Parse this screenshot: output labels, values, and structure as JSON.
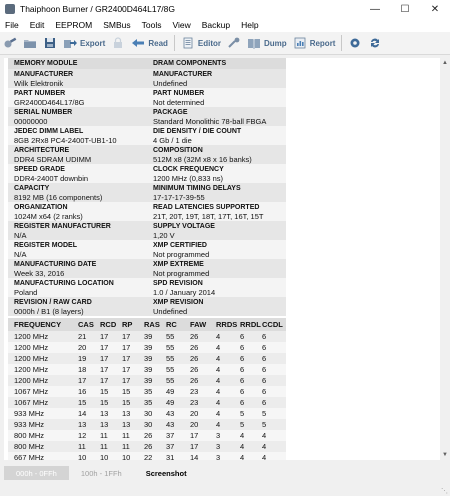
{
  "window": {
    "title": "Thaiphoon Burner / GR2400D464L17/8G"
  },
  "menu": [
    "File",
    "Edit",
    "EEPROM",
    "SMBus",
    "Tools",
    "View",
    "Backup",
    "Help"
  ],
  "toolbar": {
    "export": "Export",
    "read": "Read",
    "editor": "Editor",
    "dump": "Dump",
    "report": "Report"
  },
  "info": [
    {
      "left": {
        "label": "MEMORY MODULE",
        "value": ""
      },
      "right": {
        "label": "DRAM COMPONENTS",
        "value": ""
      }
    },
    {
      "left": {
        "label": "Manufacturer",
        "value": "Wilk Elektronik"
      },
      "right": {
        "label": "Manufacturer",
        "value": "Undefined"
      }
    },
    {
      "left": {
        "label": "Part Number",
        "value": "GR2400D464L17/8G"
      },
      "right": {
        "label": "Part Number",
        "value": "Not determined"
      }
    },
    {
      "left": {
        "label": "Serial Number",
        "value": "00000000"
      },
      "right": {
        "label": "Package",
        "value": "Standard Monolithic 78-ball FBGA"
      }
    },
    {
      "left": {
        "label": "JEDEC DIMM Label",
        "value": "8GB 2Rx8 PC4-2400T-UB1-10"
      },
      "right": {
        "label": "Die Density / Die Count",
        "value": "4 Gb / 1 die"
      }
    },
    {
      "left": {
        "label": "Architecture",
        "value": "DDR4 SDRAM UDIMM"
      },
      "right": {
        "label": "Composition",
        "value": "512M x8 (32M x8 x 16 banks)"
      }
    },
    {
      "left": {
        "label": "Speed Grade",
        "value": "DDR4-2400T downbin"
      },
      "right": {
        "label": "Clock Frequency",
        "value": "1200 MHz (0,833 ns)"
      }
    },
    {
      "left": {
        "label": "Capacity",
        "value": "8192 MB (16 components)"
      },
      "right": {
        "label": "Minimum Timing Delays",
        "value": "17-17-17-39-55"
      }
    },
    {
      "left": {
        "label": "Organization",
        "value": "1024M x64 (2 ranks)"
      },
      "right": {
        "label": "Read Latencies Supported",
        "value": "21T, 20T, 19T, 18T, 17T, 16T, 15T"
      }
    },
    {
      "left": {
        "label": "Register Manufacturer",
        "value": "N/A"
      },
      "right": {
        "label": "Supply Voltage",
        "value": "1,20 V"
      }
    },
    {
      "left": {
        "label": "Register Model",
        "value": "N/A"
      },
      "right": {
        "label": "XMP Certified",
        "value": "Not programmed"
      }
    },
    {
      "left": {
        "label": "Manufacturing Date",
        "value": "Week 33, 2016"
      },
      "right": {
        "label": "XMP Extreme",
        "value": "Not programmed"
      }
    },
    {
      "left": {
        "label": "Manufacturing Location",
        "value": "Poland"
      },
      "right": {
        "label": "SPD Revision",
        "value": "1.0 / January 2014"
      }
    },
    {
      "left": {
        "label": "Revision / Raw Card",
        "value": "0000h / B1 (8 layers)"
      },
      "right": {
        "label": "XMP Revision",
        "value": "Undefined"
      }
    }
  ],
  "timings": {
    "headers": [
      "FREQUENCY",
      "CAS",
      "RCD",
      "RP",
      "RAS",
      "RC",
      "FAW",
      "RRDS",
      "RRDL",
      "CCDL"
    ],
    "rows": [
      [
        "1200 MHz",
        "21",
        "17",
        "17",
        "39",
        "55",
        "26",
        "4",
        "6",
        "6"
      ],
      [
        "1200 MHz",
        "20",
        "17",
        "17",
        "39",
        "55",
        "26",
        "4",
        "6",
        "6"
      ],
      [
        "1200 MHz",
        "19",
        "17",
        "17",
        "39",
        "55",
        "26",
        "4",
        "6",
        "6"
      ],
      [
        "1200 MHz",
        "18",
        "17",
        "17",
        "39",
        "55",
        "26",
        "4",
        "6",
        "6"
      ],
      [
        "1200 MHz",
        "17",
        "17",
        "17",
        "39",
        "55",
        "26",
        "4",
        "6",
        "6"
      ],
      [
        "1067 MHz",
        "16",
        "15",
        "15",
        "35",
        "49",
        "23",
        "4",
        "6",
        "6"
      ],
      [
        "1067 MHz",
        "15",
        "15",
        "15",
        "35",
        "49",
        "23",
        "4",
        "6",
        "6"
      ],
      [
        "933 MHz",
        "14",
        "13",
        "13",
        "30",
        "43",
        "20",
        "4",
        "5",
        "5"
      ],
      [
        "933 MHz",
        "13",
        "13",
        "13",
        "30",
        "43",
        "20",
        "4",
        "5",
        "5"
      ],
      [
        "800 MHz",
        "12",
        "11",
        "11",
        "26",
        "37",
        "17",
        "3",
        "4",
        "4"
      ],
      [
        "800 MHz",
        "11",
        "11",
        "11",
        "26",
        "37",
        "17",
        "3",
        "4",
        "4"
      ],
      [
        "667 MHz",
        "10",
        "10",
        "10",
        "22",
        "31",
        "14",
        "3",
        "4",
        "4"
      ]
    ]
  },
  "tabs": [
    "000h - 0FFh",
    "100h - 1FFh",
    "Screenshot"
  ]
}
